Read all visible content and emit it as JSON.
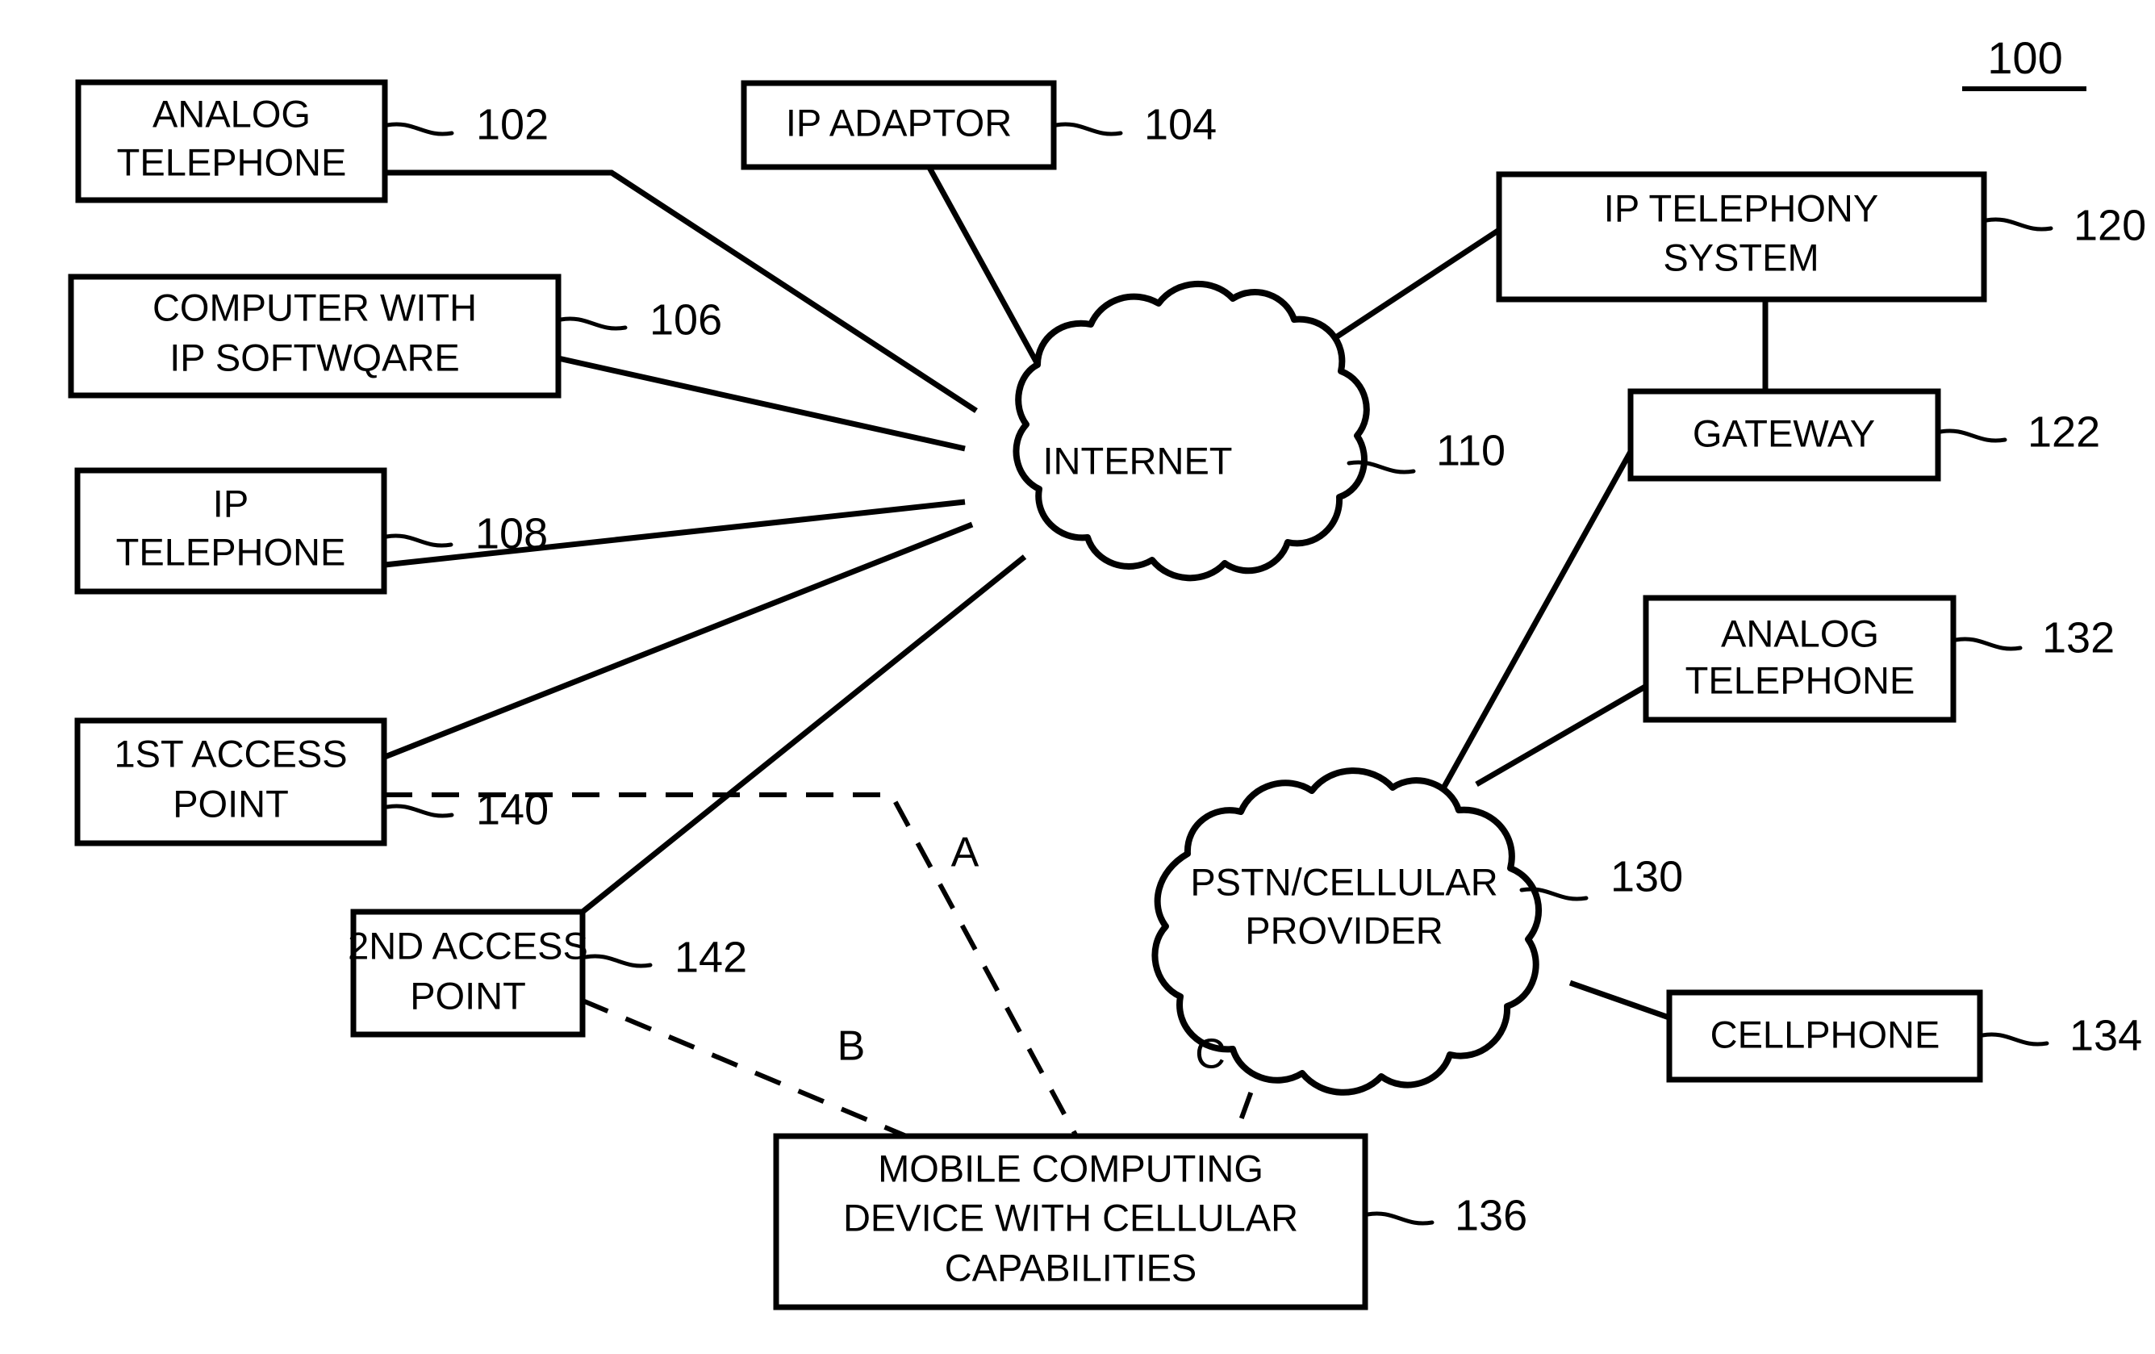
{
  "figure": {
    "number": "100",
    "underlined": true
  },
  "nodes": [
    {
      "id": "n102",
      "shape": "box",
      "ref": "102",
      "lines": [
        "ANALOG",
        "TELEPHONE"
      ]
    },
    {
      "id": "n104",
      "shape": "box",
      "ref": "104",
      "lines": [
        "IP ADAPTOR"
      ]
    },
    {
      "id": "n106",
      "shape": "box",
      "ref": "106",
      "lines": [
        "COMPUTER WITH",
        "IP SOFTWQARE"
      ]
    },
    {
      "id": "n108",
      "shape": "box",
      "ref": "108",
      "lines": [
        "IP",
        "TELEPHONE"
      ]
    },
    {
      "id": "n110",
      "shape": "cloud",
      "ref": "110",
      "lines": [
        "INTERNET"
      ]
    },
    {
      "id": "n120",
      "shape": "box",
      "ref": "120",
      "lines": [
        "IP TELEPHONY",
        "SYSTEM"
      ]
    },
    {
      "id": "n122",
      "shape": "box",
      "ref": "122",
      "lines": [
        "GATEWAY"
      ]
    },
    {
      "id": "n130",
      "shape": "cloud",
      "ref": "130",
      "lines": [
        "PSTN/CELLULAR",
        "PROVIDER"
      ]
    },
    {
      "id": "n132",
      "shape": "box",
      "ref": "132",
      "lines": [
        "ANALOG",
        "TELEPHONE"
      ]
    },
    {
      "id": "n134",
      "shape": "box",
      "ref": "134",
      "lines": [
        "CELLPHONE"
      ]
    },
    {
      "id": "n136",
      "shape": "box",
      "ref": "136",
      "lines": [
        "MOBILE COMPUTING",
        "DEVICE WITH CELLULAR",
        "CAPABILITIES"
      ]
    },
    {
      "id": "n140",
      "shape": "box",
      "ref": "140",
      "lines": [
        "1ST ACCESS",
        "POINT"
      ]
    },
    {
      "id": "n142",
      "shape": "box",
      "ref": "142",
      "lines": [
        "2ND ACCESS",
        "POINT"
      ]
    }
  ],
  "path_labels": [
    {
      "id": "pathA",
      "text": "A"
    },
    {
      "id": "pathB",
      "text": "B"
    },
    {
      "id": "pathC",
      "text": "C"
    }
  ],
  "colors": {
    "stroke": "#000000",
    "fill": "#ffffff"
  }
}
